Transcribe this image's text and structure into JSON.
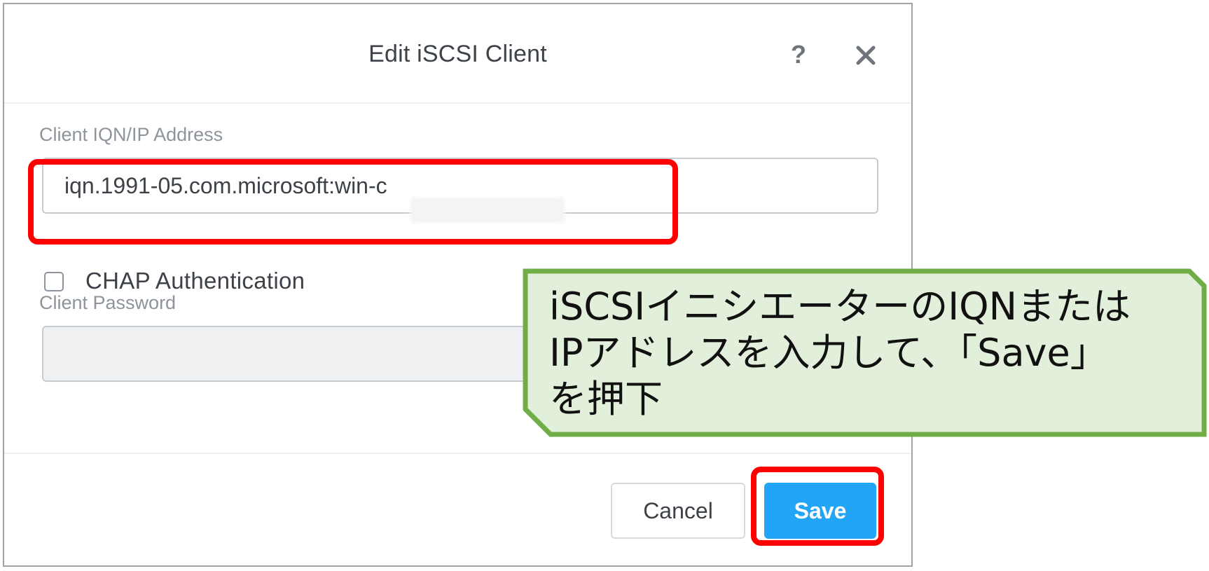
{
  "dialog": {
    "title": "Edit iSCSI Client",
    "help_label": "?",
    "iqn_field": {
      "label": "Client IQN/IP Address",
      "value": "iqn.1991-05.com.microsoft:win-c"
    },
    "chap": {
      "label": "CHAP Authentication",
      "checked": false
    },
    "password_field": {
      "label": "Client Password",
      "value": ""
    },
    "buttons": {
      "cancel": "Cancel",
      "save": "Save"
    }
  },
  "annotation": {
    "lines": [
      "iSCSIイニシエーターのIQNまたは",
      "IPアドレスを入力して、「Save」",
      "を押下"
    ]
  },
  "colors": {
    "highlight": "#ff0000",
    "callout_fill": "#e2efda",
    "callout_border": "#70ad47",
    "save_button": "#22a5f7"
  },
  "icons": {
    "help": "help-icon",
    "close": "close-icon",
    "checkbox": "checkbox-icon"
  }
}
